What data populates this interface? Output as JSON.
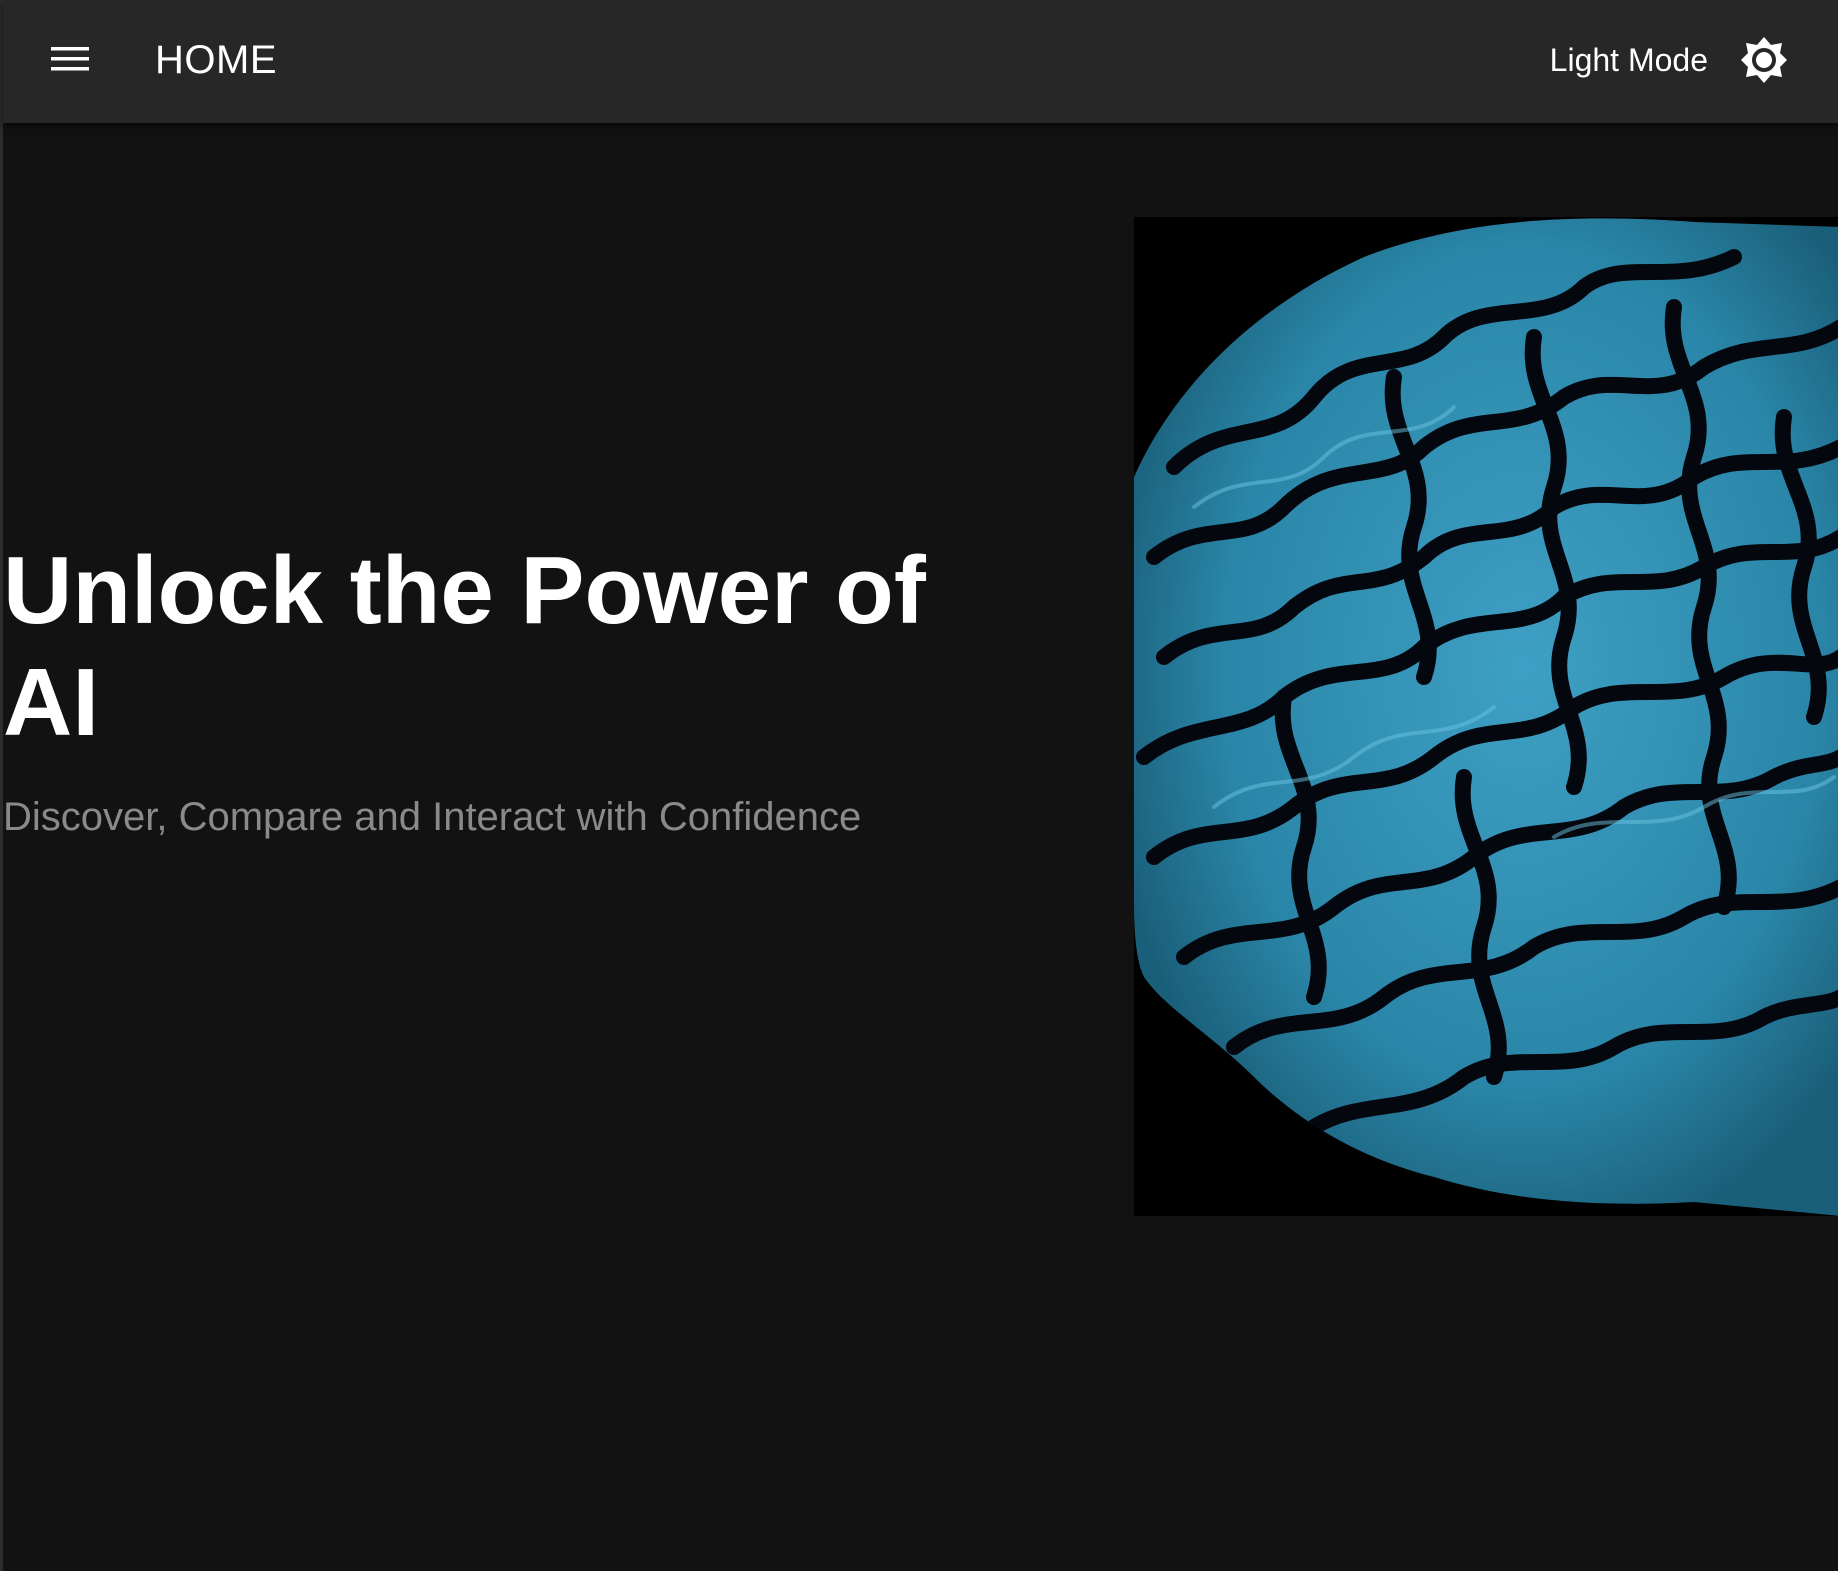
{
  "appbar": {
    "menu_icon": "menu-icon",
    "title": "HOME",
    "theme_toggle_label": "Light Mode",
    "theme_icon": "brightness-icon"
  },
  "hero": {
    "heading": "Unlock the Power of AI",
    "subtitle": "Discover, Compare and Interact with Confidence",
    "image_alt": "Blue human brain illustration"
  },
  "colors": {
    "background": "#121212",
    "appbar": "#272727",
    "text_primary": "#ffffff",
    "text_secondary": "#8a8a8a",
    "brain_blue": "#2a86a8"
  }
}
